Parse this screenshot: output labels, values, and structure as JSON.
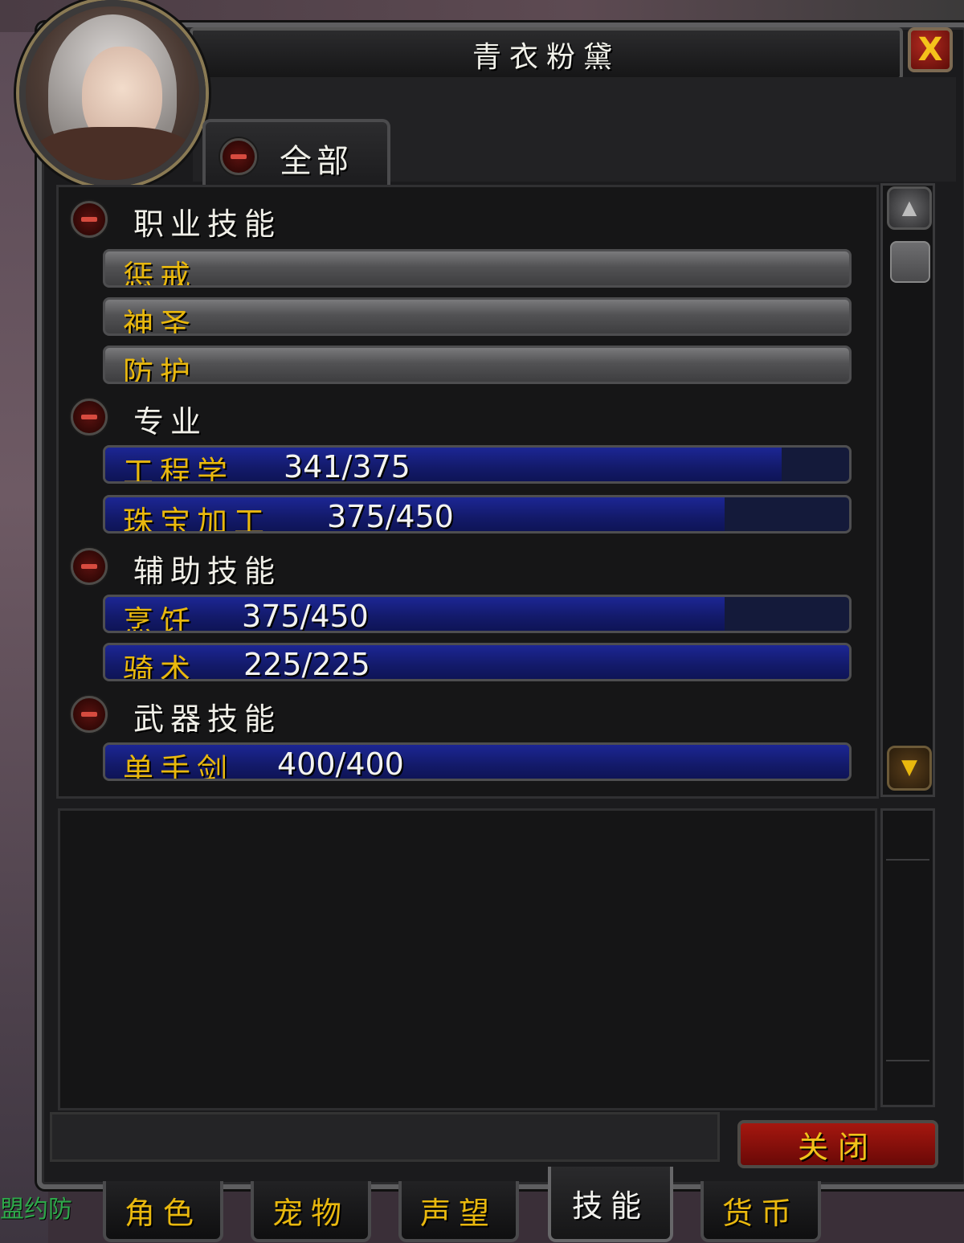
{
  "window": {
    "title": "青衣粉黛",
    "close_glyph": "X"
  },
  "filter_tab": {
    "label": "全部"
  },
  "side_text": "盟约防",
  "categories": [
    {
      "label": "职业技能"
    },
    {
      "label": "专业"
    },
    {
      "label": "辅助技能"
    },
    {
      "label": "武器技能"
    }
  ],
  "skills": [
    {
      "name": "惩戒",
      "category": "职业技能"
    },
    {
      "name": "神圣",
      "category": "职业技能"
    },
    {
      "name": "防护",
      "category": "职业技能"
    },
    {
      "name": "工程学",
      "value": "341/375",
      "progress": 0.909,
      "category": "专业"
    },
    {
      "name": "珠宝加工",
      "value": "375/450",
      "progress": 0.833,
      "category": "专业"
    },
    {
      "name": "烹饪",
      "value": "375/450",
      "progress": 0.833,
      "category": "辅助技能"
    },
    {
      "name": "骑术",
      "value": "225/225",
      "progress": 1.0,
      "category": "辅助技能"
    },
    {
      "name": "单手剑",
      "value": "400/400",
      "progress": 1.0,
      "category": "武器技能"
    }
  ],
  "buttons": {
    "close_label": "关闭"
  },
  "bottom_tabs": [
    {
      "label": "角色"
    },
    {
      "label": "宠物"
    },
    {
      "label": "声望"
    },
    {
      "label": "技能",
      "active": true
    },
    {
      "label": "货币"
    }
  ],
  "colors": {
    "accent_gold": "#e9b80e",
    "bar_blue": "#1c2694",
    "button_red": "#a5170f"
  }
}
